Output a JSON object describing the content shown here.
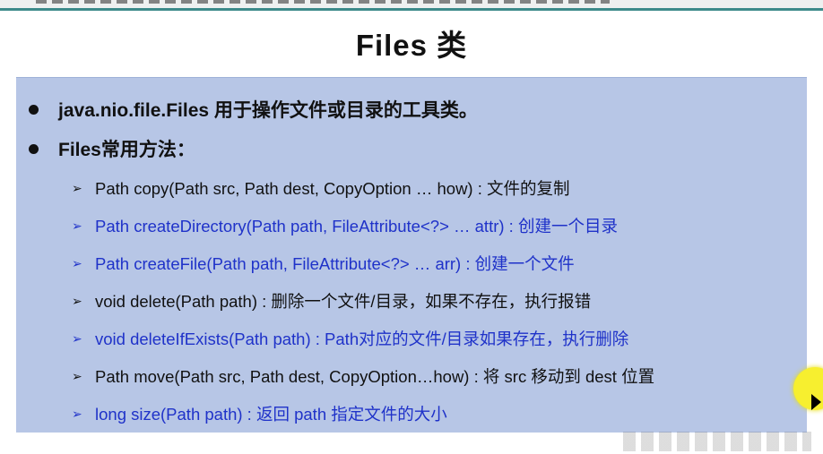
{
  "slide": {
    "title": "Files 类",
    "bullets": [
      "java.nio.file.Files 用于操作文件或目录的工具类。",
      "Files常用方法："
    ],
    "methods": [
      {
        "text": "Path copy(Path src, Path dest, CopyOption … how) : 文件的复制",
        "color": "#111111"
      },
      {
        "text": "Path createDirectory(Path path, FileAttribute<?> … attr) : 创建一个目录",
        "color": "#1f32c9"
      },
      {
        "text": "Path createFile(Path path, FileAttribute<?> … arr) : 创建一个文件",
        "color": "#1f32c9"
      },
      {
        "text": "void delete(Path path) : 删除一个文件/目录，如果不存在，执行报错",
        "color": "#111111"
      },
      {
        "text": "void deleteIfExists(Path path) : Path对应的文件/目录如果存在，执行删除",
        "color": "#1f32c9"
      },
      {
        "text": "Path move(Path src, Path dest, CopyOption…how) : 将 src 移动到 dest 位置",
        "color": "#111111"
      },
      {
        "text": "long size(Path path) : 返回 path 指定文件的大小",
        "color": "#1f32c9"
      }
    ],
    "arrow_glyph": "➢",
    "panel_color": "#b7c6e6",
    "cursor_highlight_color": "#f7ef2f"
  }
}
